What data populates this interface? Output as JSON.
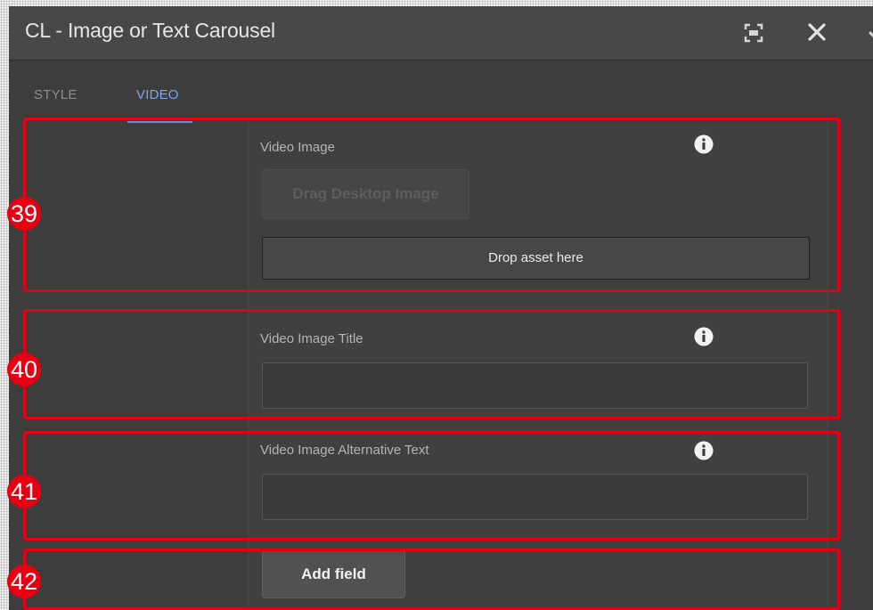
{
  "dialog": {
    "title": "CL - Image or Text Carousel",
    "fullscreen_icon": "fullscreen-icon",
    "close_icon": "close-icon"
  },
  "tabs": [
    {
      "label": "STYLE",
      "active": false
    },
    {
      "label": "VIDEO",
      "active": true
    }
  ],
  "fields": {
    "video_image": {
      "label": "Video Image",
      "drag_button": "Drag Desktop Image",
      "drop_zone": "Drop asset here"
    },
    "video_image_title": {
      "label": "Video Image Title",
      "value": ""
    },
    "video_image_alt": {
      "label": "Video Image Alternative Text",
      "value": ""
    },
    "add_field": "Add field"
  },
  "annotations": [
    "39",
    "40",
    "41",
    "42"
  ],
  "colors": {
    "annotation": "#e60012",
    "active_tab": "#7aa8ea",
    "dialog_bg": "#3d3d3d"
  }
}
